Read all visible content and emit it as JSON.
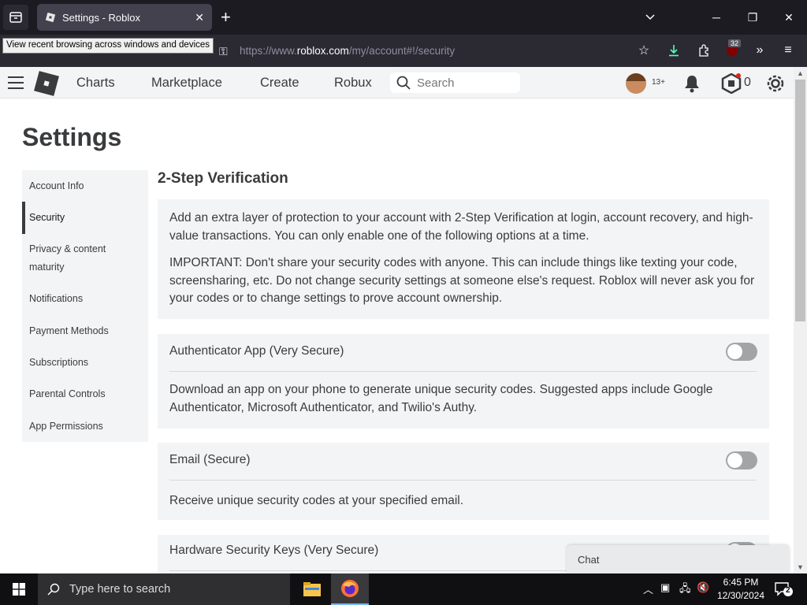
{
  "browser": {
    "tab_title": "Settings - Roblox",
    "tooltip": "View recent browsing across windows and devices",
    "url_prefix": "https://www.",
    "url_host": "roblox.com",
    "url_path": "/my/account#!/security",
    "extension_badge": "32"
  },
  "header": {
    "nav": [
      "Charts",
      "Marketplace",
      "Create",
      "Robux"
    ],
    "search_placeholder": "Search",
    "age_label": "13+",
    "robux_count": "0"
  },
  "page": {
    "title": "Settings",
    "sidebar": [
      {
        "label": "Account Info",
        "active": false
      },
      {
        "label": "Security",
        "active": true
      },
      {
        "label": "Privacy & content maturity",
        "active": false
      },
      {
        "label": "Notifications",
        "active": false
      },
      {
        "label": "Payment Methods",
        "active": false
      },
      {
        "label": "Subscriptions",
        "active": false
      },
      {
        "label": "Parental Controls",
        "active": false
      },
      {
        "label": "App Permissions",
        "active": false
      }
    ],
    "section_title": "2-Step Verification",
    "intro": "Add an extra layer of protection to your account with 2-Step Verification at login, account recovery, and high-value transactions. You can only enable one of the following options at a time.",
    "important": "IMPORTANT: Don't share your security codes with anyone. This can include things like texting your code, screensharing, etc. Do not change security settings at someone else's request. Roblox will never ask you for your codes or to change settings to prove account ownership.",
    "options": [
      {
        "title": "Authenticator App (Very Secure)",
        "description": "Download an app on your phone to generate unique security codes. Suggested apps include Google Authenticator, Microsoft Authenticator, and Twilio's Authy.",
        "enabled": false
      },
      {
        "title": "Email (Secure)",
        "description": "Receive unique security codes at your specified email.",
        "enabled": false
      },
      {
        "title": "Hardware Security Keys (Very Secure)",
        "description": "",
        "enabled": false
      }
    ],
    "chat_label": "Chat"
  },
  "taskbar": {
    "search_placeholder": "Type here to search",
    "time": "6:45 PM",
    "date": "12/30/2024",
    "notification_count": "2"
  }
}
